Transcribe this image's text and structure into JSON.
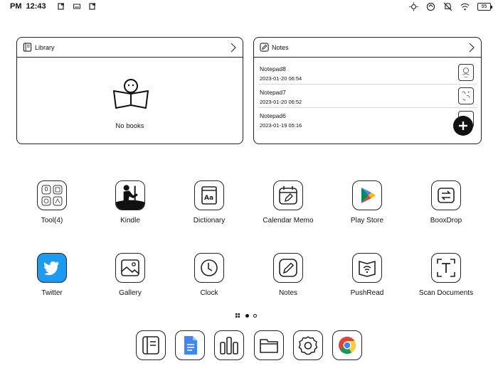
{
  "status_bar": {
    "ampm": "PM",
    "time": "12:43",
    "left_icons": [
      "notification-icon",
      "keyboard-icon",
      "notification-icon-2"
    ],
    "right_icons": [
      "brightness-icon",
      "sync-icon",
      "do-not-disturb-icon",
      "wifi-icon"
    ],
    "battery": "95"
  },
  "library": {
    "title": "Library",
    "empty_text": "No books"
  },
  "notes": {
    "title": "Notes",
    "items": [
      {
        "name": "Notepad8",
        "date": "2023-01-20 06:54"
      },
      {
        "name": "Notepad7",
        "date": "2023-01-20 06:52"
      },
      {
        "name": "Notepad6",
        "date": "2023-01-19 05:16"
      }
    ]
  },
  "apps_row1": [
    {
      "label": "Tool(4)",
      "icon": "tool-folder-icon"
    },
    {
      "label": "Kindle",
      "icon": "kindle-icon"
    },
    {
      "label": "Dictionary",
      "icon": "dictionary-icon"
    },
    {
      "label": "Calendar Memo",
      "icon": "calendar-memo-icon"
    },
    {
      "label": "Play Store",
      "icon": "play-store-icon"
    },
    {
      "label": "BooxDrop",
      "icon": "booxdrop-icon"
    }
  ],
  "apps_row2": [
    {
      "label": "Twitter",
      "icon": "twitter-icon"
    },
    {
      "label": "Gallery",
      "icon": "gallery-icon"
    },
    {
      "label": "Clock",
      "icon": "clock-icon"
    },
    {
      "label": "Notes",
      "icon": "notes-icon"
    },
    {
      "label": "PushRead",
      "icon": "pushread-icon"
    },
    {
      "label": "Scan Documents",
      "icon": "scan-documents-icon"
    }
  ],
  "pager": {
    "pages": 2,
    "current": 1
  },
  "dock": [
    "library-icon",
    "docs-icon",
    "apps-icon",
    "files-icon",
    "settings-icon",
    "chrome-icon"
  ],
  "colors": {
    "twitter": "#1d9bf0",
    "docs": "#4285f4",
    "play_green": "#01875f",
    "play_blue": "#4285f4",
    "play_yellow": "#fbbc04",
    "play_red": "#ea4335"
  }
}
